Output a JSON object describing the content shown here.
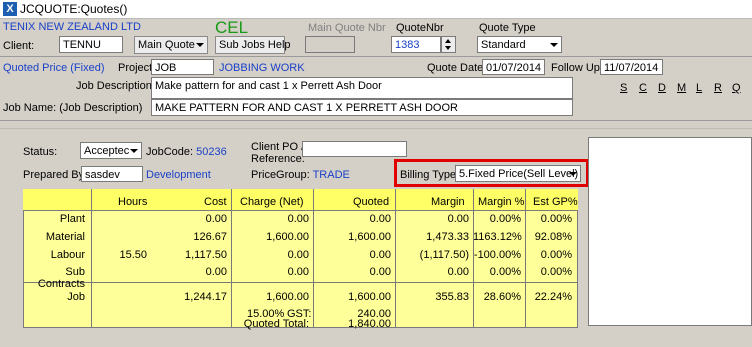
{
  "window": {
    "title": "JCQUOTE:Quotes()"
  },
  "header": {
    "company": "TENIX NEW ZEALAND LTD",
    "code": "CEL",
    "client_label": "Client:",
    "client_value": "TENNU",
    "main_quote_label": "Main Quote",
    "sub_jobs_help_label": "Sub Jobs Help",
    "main_quote_nbr_label": "Main Quote Nbr",
    "quote_nbr_label": "QuoteNbr",
    "quote_nbr_value": "1383",
    "quote_type_label": "Quote Type",
    "quote_type_value": "Standard"
  },
  "details": {
    "quoted_price_label": "Quoted Price (Fixed)",
    "project_label": "Project",
    "project_value": "JOB",
    "project_desc": "JOBBING WORK",
    "quote_date_label": "Quote Date:",
    "quote_date_value": "01/07/2014",
    "follow_up_label": "Follow Up:",
    "follow_up_value": "11/07/2014",
    "job_desc_label": "Job  Description:",
    "job_desc_value": "Make pattern for and cast 1 x Perrett Ash Door",
    "job_name_label": "Job Name:  (Job Description)",
    "job_name_value": "MAKE PATTERN FOR AND CAST 1 X PERRETT ASH DOOR",
    "letters": [
      "S",
      "C",
      "D",
      "M",
      "L",
      "R",
      "Q"
    ]
  },
  "status": {
    "status_label": "Status:",
    "status_value": "Acceptec",
    "jobcode_label": "JobCode:",
    "jobcode_value": "50236",
    "client_po_label": "Client PO /",
    "reference_label": "Reference:",
    "prepared_by_label": "Prepared By:",
    "prepared_by_value": "sasdev",
    "department": "Development",
    "pricegroup_label": "PriceGroup:",
    "pricegroup_value": "TRADE",
    "billing_type_label": "Billing Type:",
    "billing_type_value": "5.Fixed Price(Sell Level)"
  },
  "grid": {
    "headers": [
      "Hours",
      "Cost",
      "Charge (Net)",
      "Quoted",
      "Margin",
      "Margin %",
      "Est GP%"
    ],
    "rows": [
      {
        "label": "Plant",
        "hours": "",
        "cost": "0.00",
        "charge": "0.00",
        "quoted": "0.00",
        "margin": "0.00",
        "margin_pct": "0.00%",
        "gp": "0.00%"
      },
      {
        "label": "Material",
        "hours": "",
        "cost": "126.67",
        "charge": "1,600.00",
        "quoted": "1,600.00",
        "margin": "1,473.33",
        "margin_pct": "1163.12%",
        "gp": "92.08%"
      },
      {
        "label": "Labour",
        "hours": "15.50",
        "cost": "1,117.50",
        "charge": "0.00",
        "quoted": "0.00",
        "margin": "(1,117.50)",
        "margin_pct": "-100.00%",
        "gp": "0.00%"
      },
      {
        "label": "Sub Contracts",
        "hours": "",
        "cost": "0.00",
        "charge": "0.00",
        "quoted": "0.00",
        "margin": "0.00",
        "margin_pct": "0.00%",
        "gp": "0.00%"
      }
    ],
    "total": {
      "label": "Job",
      "cost": "1,244.17",
      "charge": "1,600.00",
      "quoted": "1,600.00",
      "margin": "355.83",
      "margin_pct": "28.60%",
      "gp": "22.24%"
    },
    "gst_rate": "15.00%",
    "gst_label": "GST:",
    "gst_value": "240.00",
    "quoted_total_label": "Quoted Total:",
    "quoted_total_value": "1,840.00"
  }
}
